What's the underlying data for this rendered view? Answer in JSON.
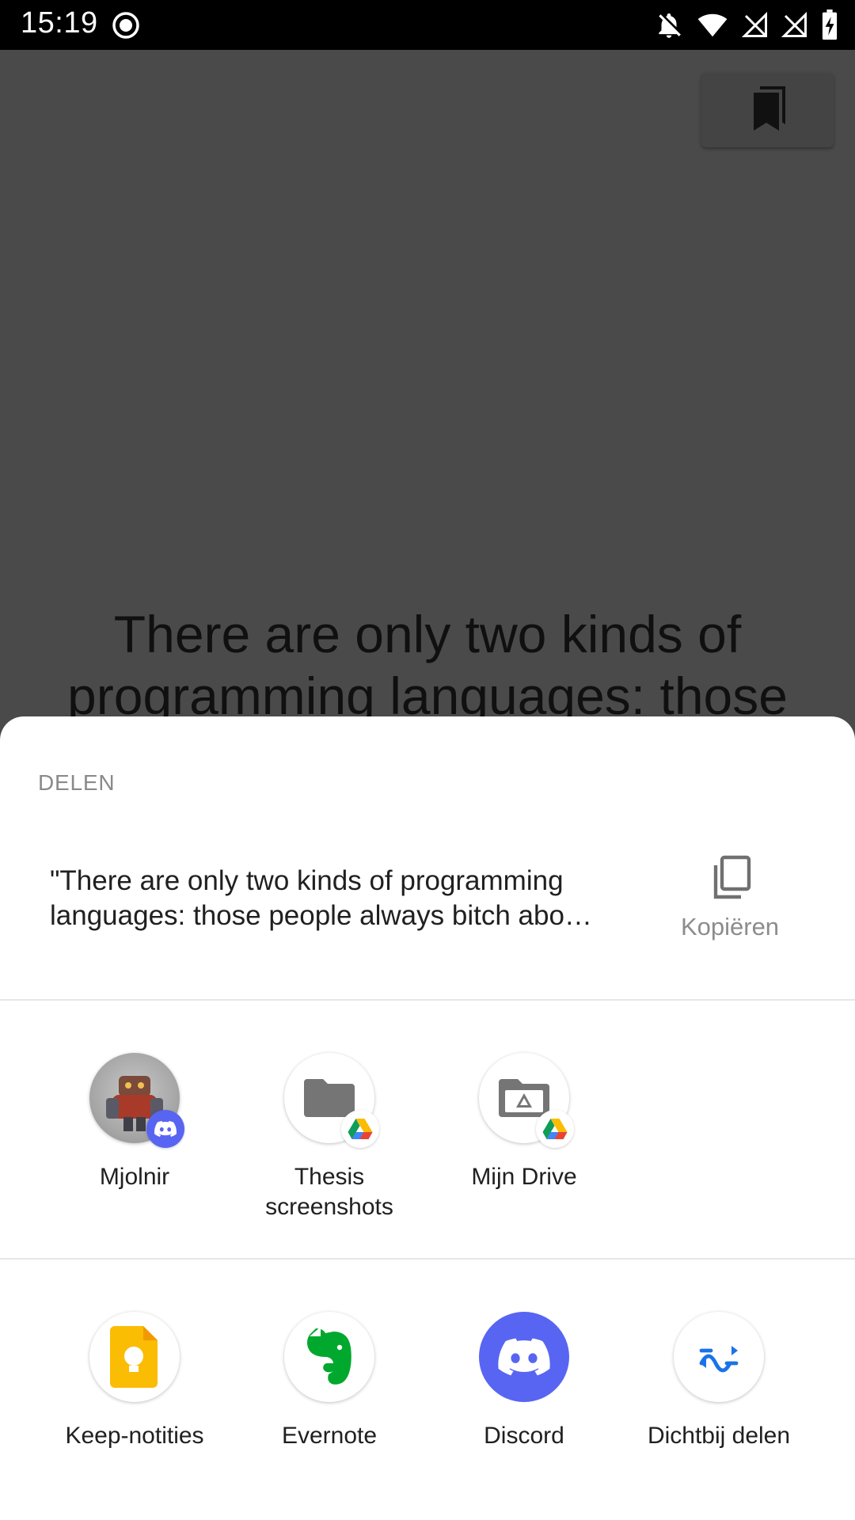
{
  "status_bar": {
    "time": "15:19",
    "icons": [
      "record-icon",
      "notifications-off-icon",
      "wifi-icon",
      "signal-off-icon",
      "signal-off-icon",
      "battery-charging-icon"
    ]
  },
  "background_app": {
    "quote_line1": "There are only two kinds of",
    "quote_line2": "programming languages: those",
    "bookmark_icon": "bookmarks-icon"
  },
  "share_sheet": {
    "title": "DELEN",
    "preview_text": "\"There are only two kinds of programming languages: those people always bitch abo…",
    "copy_label": "Kopiëren",
    "direct_targets": [
      {
        "label": "Mjolnir",
        "icon": "discord-avatar",
        "badge": "discord-badge"
      },
      {
        "label": "Thesis screenshots",
        "icon": "folder-icon",
        "badge": "google-drive-badge"
      },
      {
        "label": "Mijn Drive",
        "icon": "drive-folder-icon",
        "badge": "google-drive-badge"
      }
    ],
    "apps": [
      {
        "label": "Keep-notities",
        "icon": "google-keep-icon"
      },
      {
        "label": "Evernote",
        "icon": "evernote-icon"
      },
      {
        "label": "Discord",
        "icon": "discord-icon"
      },
      {
        "label": "Dichtbij delen",
        "icon": "nearby-share-icon"
      }
    ]
  },
  "colors": {
    "scrim": "#4a4a4a",
    "discord": "#5865f2",
    "keep": "#fbbc04",
    "evernote": "#00a82d",
    "nearby": "#1a73e8"
  }
}
